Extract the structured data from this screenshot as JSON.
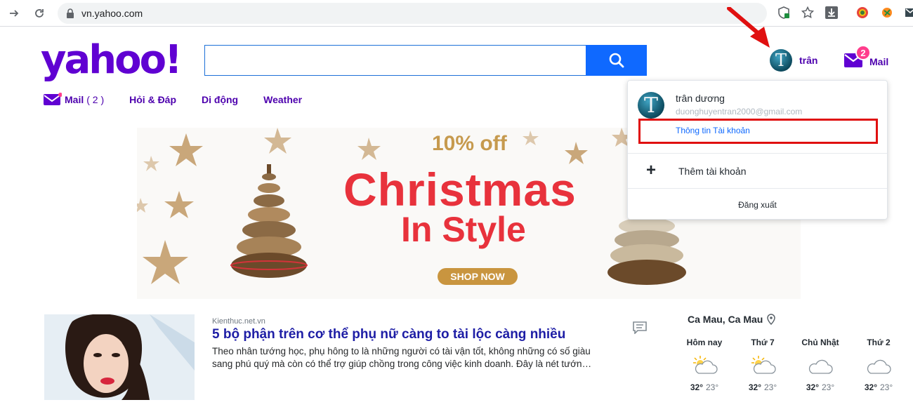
{
  "browser": {
    "url": "vn.yahoo.com"
  },
  "header": {
    "logo_text": "yahoo!",
    "user_name": "trân",
    "mail_label": "Mail",
    "mail_badge": "2"
  },
  "nav": {
    "items": [
      {
        "label": "Mail",
        "count": "( 2 )"
      },
      {
        "label": "Hỏi & Đáp"
      },
      {
        "label": "Di động"
      },
      {
        "label": "Weather"
      }
    ]
  },
  "banner": {
    "offer": "10% off",
    "line1": "Christmas",
    "line2": "In Style",
    "cta": "SHOP NOW"
  },
  "account_menu": {
    "avatar_letter": "T",
    "name": "trân dương",
    "email": "duonghuyentran2000@gmail.com",
    "account_info_link": "Thông tin Tài khoản",
    "add_account": "Thêm tài khoản",
    "logout": "Đăng xuất"
  },
  "news": {
    "source": "Kienthuc.net.vn",
    "title": "5 bộ phận trên cơ thể phụ nữ càng to tài lộc càng nhiều",
    "description": "Theo nhân tướng học, phụ hông to là những người có tài vận tốt, không những có số giàu sang phú quý mà còn có thể trợ giúp chồng trong công việc kinh doanh. Đây là nét tướn…"
  },
  "weather": {
    "location": "Ca Mau, Ca Mau",
    "days": [
      {
        "label": "Hôm nay",
        "high": "32°",
        "low": "23°",
        "icon": "partly-cloudy-icon"
      },
      {
        "label": "Thứ 7",
        "high": "32°",
        "low": "23°",
        "icon": "partly-cloudy-icon"
      },
      {
        "label": "Chủ Nhật",
        "high": "32°",
        "low": "23°",
        "icon": "cloudy-icon"
      },
      {
        "label": "Thứ 2",
        "high": "32°",
        "low": "23°",
        "icon": "cloudy-icon"
      }
    ]
  },
  "colors": {
    "brand": "#6001d2",
    "link_purple": "#4d00ae",
    "search_blue": "#0f69ff",
    "highlight_red": "#e01010"
  }
}
